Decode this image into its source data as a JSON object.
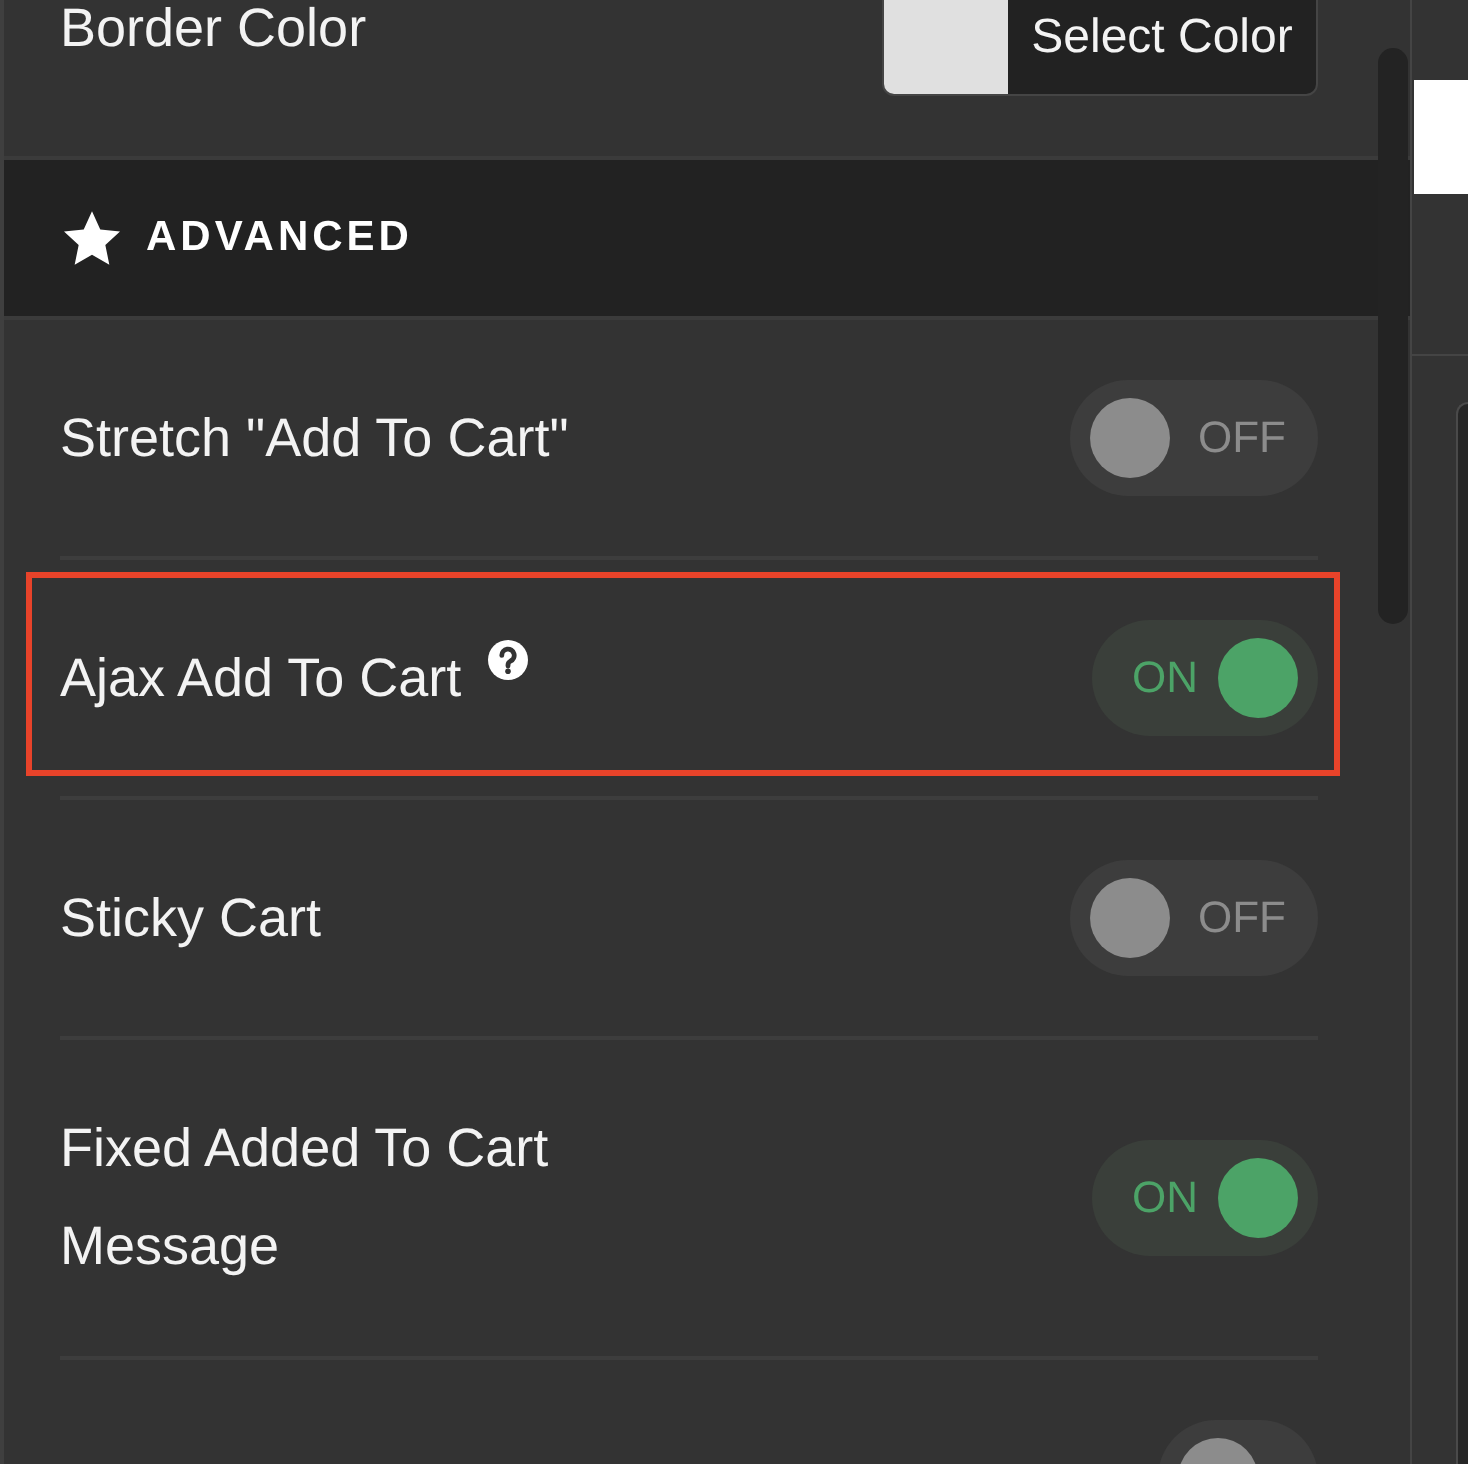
{
  "panel": {
    "items": [
      {
        "kind": "color",
        "label": "Border Color",
        "color": "#e0e0e0",
        "button": "Select Color"
      },
      {
        "kind": "section",
        "title": "ADVANCED"
      },
      {
        "kind": "toggle",
        "label": "Stretch \"Add To Cart\"",
        "help": false,
        "highlighted": false,
        "on": false,
        "state_text": "OFF"
      },
      {
        "kind": "toggle",
        "label": "Ajax Add To Cart",
        "help": true,
        "highlighted": true,
        "on": true,
        "state_text": "ON"
      },
      {
        "kind": "toggle",
        "label": "Sticky Cart",
        "help": false,
        "highlighted": false,
        "on": false,
        "state_text": "OFF"
      },
      {
        "kind": "toggle",
        "label": "Fixed Added To Cart Message",
        "help": false,
        "highlighted": false,
        "on": true,
        "state_text": "ON"
      },
      {
        "kind": "toggle",
        "help": false,
        "highlighted": false,
        "on": false
      }
    ]
  }
}
